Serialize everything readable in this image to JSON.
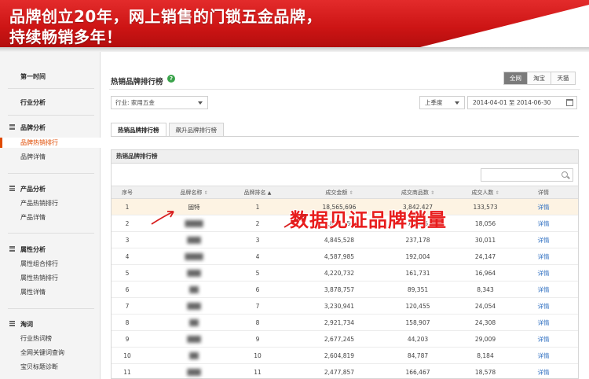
{
  "banner": {
    "line1": "品牌创立20年，网上销售的门锁五金品牌，",
    "line2": "持续畅销多年！"
  },
  "sidebar": {
    "first_time": "第一时间",
    "industry_analysis": "行业分析",
    "brand_analysis": "品牌分析",
    "brand_hot_ranking": "品牌热销排行",
    "brand_detail": "品牌详情",
    "product_analysis": "产品分析",
    "product_hot_ranking": "产品热销排行",
    "product_detail": "产品详情",
    "attribute_analysis": "属性分析",
    "attr_combo_ranking": "属性组合排行",
    "attr_hot_ranking": "属性热销排行",
    "attr_detail": "属性详情",
    "taoci": "淘词",
    "industry_hot_words": "行业热词榜",
    "keyword_query": "全网关键词查询",
    "title_diagnosis": "宝贝标题诊断"
  },
  "main": {
    "title": "热销品牌排行榜",
    "help": "?",
    "platforms": [
      "全网",
      "淘宝",
      "天猫"
    ],
    "industry": "行业: 家用五金",
    "quarter": "上季度",
    "date_range": "2014-04-01 至 2014-06-30",
    "tabs": [
      "热销品牌排行榜",
      "飙升品牌排行榜"
    ],
    "panel_title": "热销品牌排行榜",
    "overlay": "数据见证品牌销量",
    "columns": {
      "rank": "序号",
      "brand": "品牌名称",
      "brand_rank": "品牌排名",
      "amount": "成交金额",
      "goods": "成交商品数",
      "people": "成交人数",
      "detail": "详情"
    },
    "sort_glyph": "⇕",
    "sort_active_glyph": "▲"
  },
  "rows": [
    {
      "rank": "1",
      "brand": "固特",
      "brand_rank": "1",
      "amount": "18,565,696",
      "goods": "3,842,427",
      "people": "133,573",
      "detail": "详情"
    },
    {
      "rank": "2",
      "brand": "████",
      "brand_rank": "2",
      "amount": "6,814,150",
      "goods": "72,675",
      "people": "18,056",
      "detail": "详情"
    },
    {
      "rank": "3",
      "brand": "███",
      "brand_rank": "3",
      "amount": "4,845,528",
      "goods": "237,178",
      "people": "30,011",
      "detail": "详情"
    },
    {
      "rank": "4",
      "brand": "████",
      "brand_rank": "4",
      "amount": "4,587,985",
      "goods": "192,004",
      "people": "24,147",
      "detail": "详情"
    },
    {
      "rank": "5",
      "brand": "███",
      "brand_rank": "5",
      "amount": "4,220,732",
      "goods": "161,731",
      "people": "16,964",
      "detail": "详情"
    },
    {
      "rank": "6",
      "brand": "██",
      "brand_rank": "6",
      "amount": "3,878,757",
      "goods": "89,351",
      "people": "8,343",
      "detail": "详情"
    },
    {
      "rank": "7",
      "brand": "███",
      "brand_rank": "7",
      "amount": "3,230,941",
      "goods": "120,455",
      "people": "24,054",
      "detail": "详情"
    },
    {
      "rank": "8",
      "brand": "██",
      "brand_rank": "8",
      "amount": "2,921,734",
      "goods": "158,907",
      "people": "24,308",
      "detail": "详情"
    },
    {
      "rank": "9",
      "brand": "███",
      "brand_rank": "9",
      "amount": "2,677,245",
      "goods": "44,203",
      "people": "29,009",
      "detail": "详情"
    },
    {
      "rank": "10",
      "brand": "██",
      "brand_rank": "10",
      "amount": "2,604,819",
      "goods": "84,787",
      "people": "8,184",
      "detail": "详情"
    },
    {
      "rank": "11",
      "brand": "███",
      "brand_rank": "11",
      "amount": "2,477,857",
      "goods": "166,467",
      "people": "18,578",
      "detail": "详情"
    }
  ],
  "colors": {
    "banner_red": "#cc1414",
    "accent_orange": "#e04a00",
    "highlight_row": "#fdf3e3",
    "link_blue": "#2a6cc0",
    "overlay_red": "#e81c1c",
    "arrow_red": "#d81e1e"
  }
}
